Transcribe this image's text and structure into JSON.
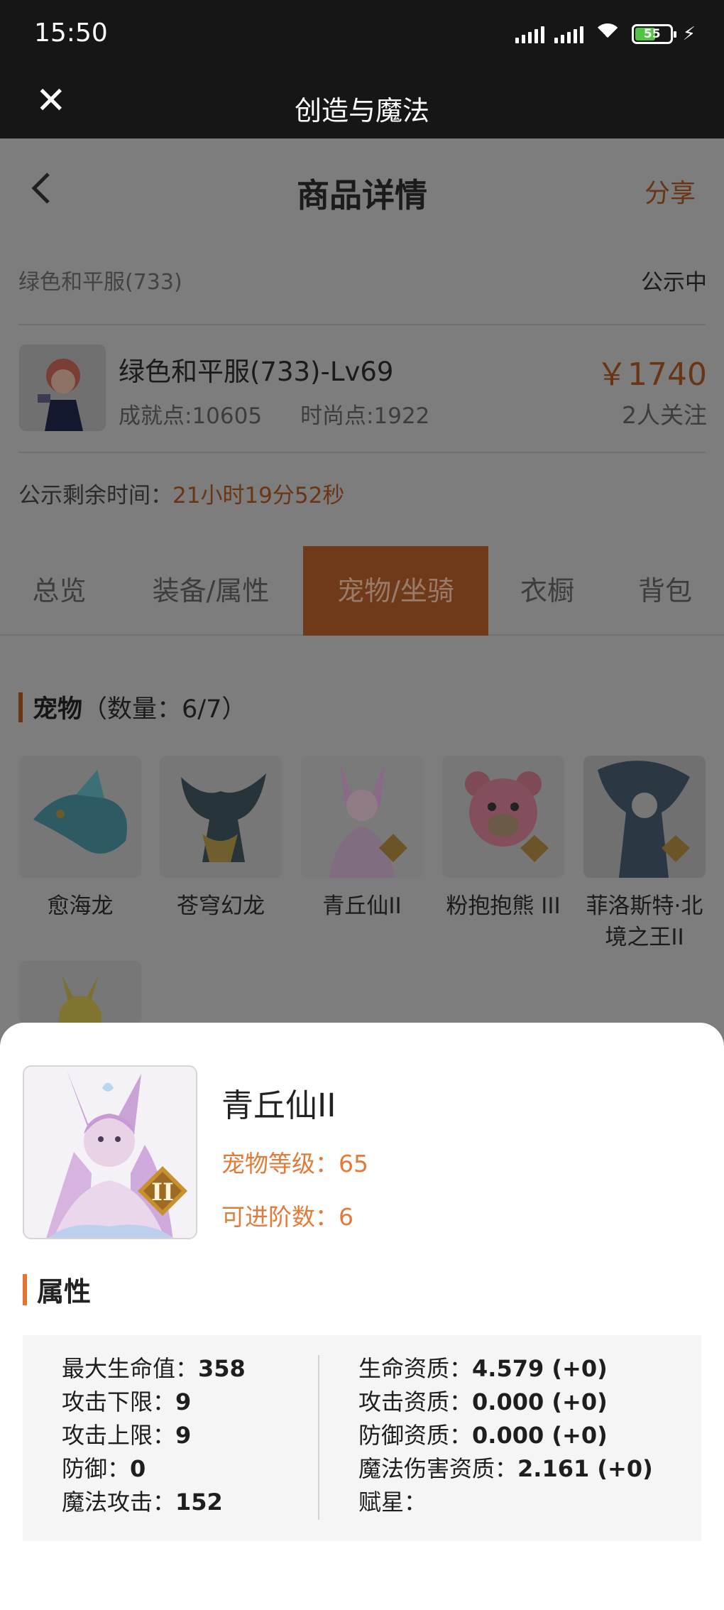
{
  "status_bar": {
    "time": "15:50",
    "battery": "55"
  },
  "app_bar": {
    "title": "创造与魔法"
  },
  "nav": {
    "title": "商品详情",
    "share": "分享"
  },
  "item": {
    "server": "绿色和平服(733)",
    "status": "公示中",
    "name": "绿色和平服(733)-Lv69",
    "achievement": "成就点:10605",
    "fashion": "时尚点:1922",
    "price": "￥1740",
    "followers": "2人关注",
    "remaining_label": "公示剩余时间：",
    "remaining_value": "21小时19分52秒"
  },
  "tabs": [
    {
      "label": "总览"
    },
    {
      "label": "装备/属性"
    },
    {
      "label": "宠物/坐骑",
      "active": true
    },
    {
      "label": "衣橱"
    },
    {
      "label": "背包"
    }
  ],
  "pets_section": {
    "title": "宠物",
    "count": "（数量：6/7）"
  },
  "pets": [
    {
      "name": "愈海龙"
    },
    {
      "name": "苍穹幻龙"
    },
    {
      "name": "青丘仙II"
    },
    {
      "name": "粉抱抱熊 III"
    },
    {
      "name": "菲洛斯特·北境之王II"
    }
  ],
  "sheet": {
    "name": "青丘仙II",
    "level": "宠物等级：65",
    "advance": "可进阶数：6",
    "attr_title": "属性",
    "left_attrs": [
      {
        "label": "最大生命值：",
        "value": "358"
      },
      {
        "label": "攻击下限：",
        "value": "9"
      },
      {
        "label": "攻击上限：",
        "value": "9"
      },
      {
        "label": "防御：",
        "value": "0"
      },
      {
        "label": "魔法攻击：",
        "value": "152"
      }
    ],
    "right_attrs": [
      {
        "label": "生命资质：",
        "value": "4.579 (+0)"
      },
      {
        "label": "攻击资质：",
        "value": "0.000 (+0)"
      },
      {
        "label": "防御资质：",
        "value": "0.000 (+0)"
      },
      {
        "label": "魔法伤害资质：",
        "value": "2.161 (+0)"
      },
      {
        "label": "赋星：",
        "value": ""
      }
    ]
  },
  "colors": {
    "accent": "#e8722f",
    "dark_bar": "#161616",
    "dim_bg": "#7d7d7d"
  }
}
